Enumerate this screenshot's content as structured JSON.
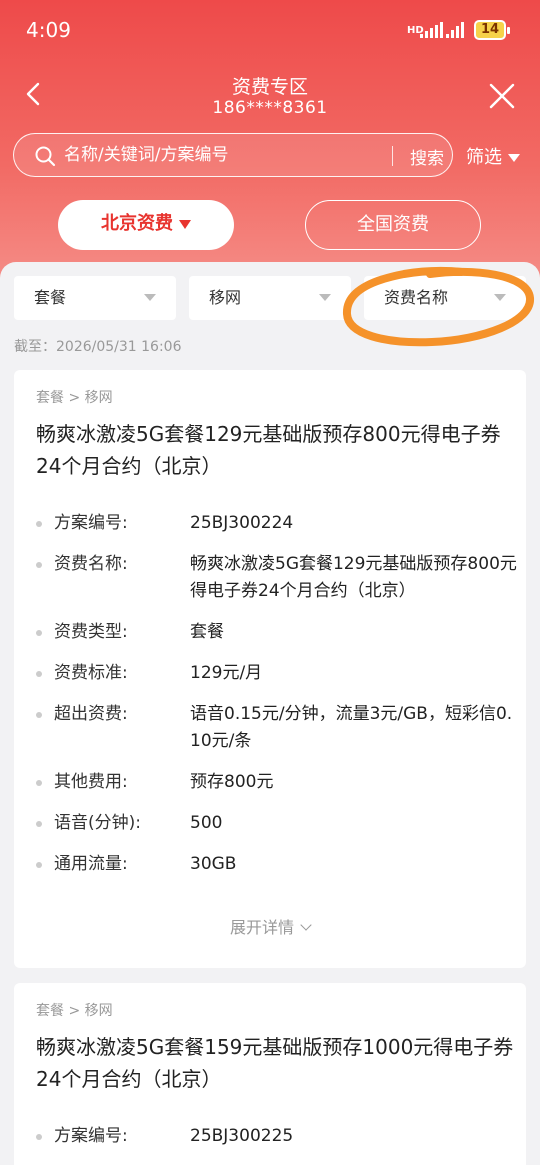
{
  "status_bar": {
    "time": "4:09",
    "network_label": "HD",
    "battery": "14"
  },
  "header": {
    "title": "资费专区",
    "phone": "186****8361"
  },
  "search": {
    "placeholder": "名称/关键词/方案编号",
    "button_label": "搜索",
    "filter_label": "筛选"
  },
  "region_tabs": {
    "beijing": "北京资费",
    "national": "全国资费"
  },
  "filters": {
    "category": "套餐",
    "operator": "移网",
    "name": "资费名称"
  },
  "as_of": "截至：2026/05/31 16:06",
  "cards": [
    {
      "breadcrumb": "套餐 > 移网",
      "title": "畅爽冰激凌5G套餐129元基础版预存800元得电子券24个月合约（北京）",
      "rows": [
        {
          "key": "方案编号:",
          "value": "25BJ300224"
        },
        {
          "key": "资费名称:",
          "value": "畅爽冰激凌5G套餐129元基础版预存800元得电子券24个月合约（北京）"
        },
        {
          "key": "资费类型:",
          "value": "套餐"
        },
        {
          "key": "资费标准:",
          "value": "129元/月"
        },
        {
          "key": "超出资费:",
          "value": "语音0.15元/分钟，流量3元/GB，短彩信0.10元/条"
        },
        {
          "key": "其他费用:",
          "value": "预存800元"
        },
        {
          "key": "语音(分钟):",
          "value": "500"
        },
        {
          "key": "通用流量:",
          "value": "30GB"
        }
      ],
      "expand_label": "展开详情"
    },
    {
      "breadcrumb": "套餐 > 移网",
      "title": "畅爽冰激凌5G套餐159元基础版预存1000元得电子券24个月合约（北京）",
      "rows": [
        {
          "key": "方案编号:",
          "value": "25BJ300225"
        }
      ]
    }
  ],
  "colors": {
    "brand_red": "#e8342f",
    "annotation_orange": "#f5922a"
  }
}
